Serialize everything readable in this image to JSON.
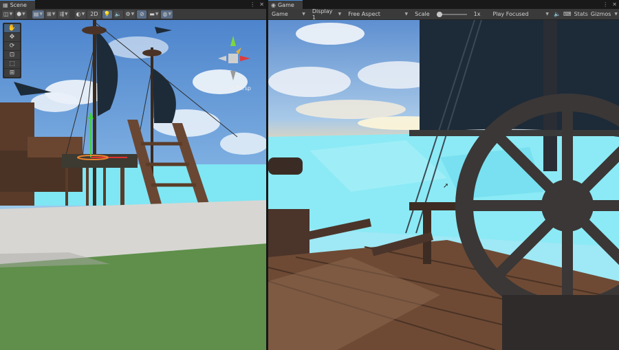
{
  "scene": {
    "tab_label": "Scene",
    "toolbar": {
      "two_d_label": "2D"
    },
    "tools": [
      {
        "name": "hand-tool",
        "glyph": "✋"
      },
      {
        "name": "move-tool",
        "glyph": "✥"
      },
      {
        "name": "rotate-tool",
        "glyph": "⟳"
      },
      {
        "name": "scale-tool",
        "glyph": "⊡"
      },
      {
        "name": "rect-tool",
        "glyph": "⬚"
      },
      {
        "name": "transform-tool",
        "glyph": "⊞"
      }
    ],
    "gizmo_label": "< Persp"
  },
  "game": {
    "tab_label": "Game",
    "display_mode": "Game",
    "display": "Display 1",
    "aspect": "Free Aspect",
    "scale_label": "Scale",
    "scale_value": "1x",
    "play_mode": "Play Focused",
    "stats_label": "Stats",
    "gizmos_label": "Gizmos"
  },
  "colors": {
    "sky": "#6b9ad6",
    "sea": "#7fe6f4",
    "deck": "#5a3d2a",
    "sail": "#1d2a38",
    "ground": "#5f8f4a"
  }
}
